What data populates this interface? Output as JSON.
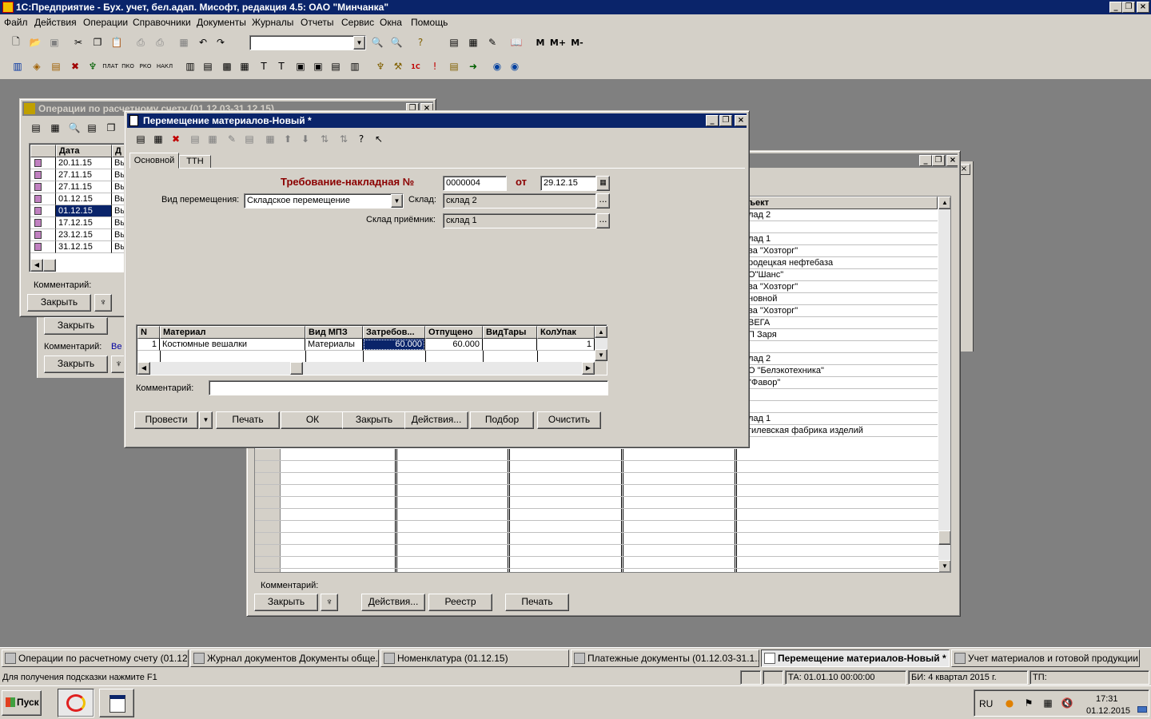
{
  "app": {
    "title": "1С:Предприятие - Бух. учет, бел.адап. Мисофт, редакция 4.5: ОАО \"Минчанка\""
  },
  "menu": [
    "Файл",
    "Действия",
    "Операции",
    "Справочники",
    "Документы",
    "Журналы",
    "Отчеты",
    "Сервис",
    "Окна",
    "Помощь"
  ],
  "toolbar": {
    "m_label": "M",
    "mplus_label": "M+",
    "mminus_label": "M-"
  },
  "win_ops": {
    "title": "Операции по расчетному счету (01.12.03-31.12.15)",
    "col_date": "Дата",
    "col_2": "Д",
    "rows": [
      {
        "date": "20.11.15",
        "d": "Вы"
      },
      {
        "date": "27.11.15",
        "d": "Вы"
      },
      {
        "date": "27.11.15",
        "d": "Вы"
      },
      {
        "date": "01.12.15",
        "d": "Вы"
      },
      {
        "date": "01.12.15",
        "d": "Вы"
      },
      {
        "date": "17.12.15",
        "d": "Вы"
      },
      {
        "date": "23.12.15",
        "d": "Вы"
      },
      {
        "date": "31.12.15",
        "d": "Вы"
      }
    ],
    "comment_label": "Комментарий:",
    "close_label": "Закрыть"
  },
  "win_behind": {
    "close_label": "Закрыть",
    "comment_label": "Комментарий:",
    "comment_value": "Ве",
    "close2_label": "Закрыть"
  },
  "win_journal": {
    "col_object": "ъект",
    "rows": [
      "лад 2",
      "",
      "лад 1",
      "ва \"Хозторг\"",
      "родецкая нефтебаза",
      "О\"Шанс\"",
      "ва \"Хозторг\"",
      "новной",
      "ва \"Хозторг\"",
      "ВЕГА",
      "П Заря",
      "",
      "лад 2",
      "О \"Белэкотехника\"",
      "\"Фавор\"",
      "",
      "",
      "лад 1",
      "гилевская фабрика изделий"
    ],
    "comment_label": "Комментарий:",
    "close_label": "Закрыть",
    "actions_label": "Действия...",
    "registry_label": "Реестр",
    "print_label": "Печать"
  },
  "win_main": {
    "title": "Перемещение материалов-Новый *",
    "tabs": [
      "Основной",
      "ТТН"
    ],
    "doc_title": "Требование-накладная №",
    "doc_number": "0000004",
    "from_label": "от",
    "doc_date": "29.12.15",
    "move_type_label": "Вид перемещения:",
    "move_type_value": "Складское перемещение",
    "warehouse_label": "Склад:",
    "warehouse_value": "склад 2",
    "receiver_label": "Склад приёмник:",
    "receiver_value": "склад 1",
    "columns": [
      "N",
      "Материал",
      "Вид МПЗ",
      "Затребов...",
      "Отпущено",
      "ВидТары",
      "КолУпак"
    ],
    "rows": [
      {
        "n": "1",
        "material": "Костюмные вешалки",
        "type": "Материалы",
        "requested": "60.000",
        "released": "60.000",
        "tare": "",
        "pack": "1"
      }
    ],
    "comment_label": "Комментарий:",
    "comment_value": "",
    "buttons": {
      "post": "Провести",
      "print": "Печать",
      "ok": "ОК",
      "close": "Закрыть",
      "actions": "Действия...",
      "select": "Подбор",
      "clear": "Очистить"
    }
  },
  "taskbar_windows": [
    "Операции по расчетному счету (01.12....",
    "Журнал документов  Документы обще...",
    "Номенклатура  (01.12.15)",
    "Платежные документы (01.12.03-31.1...",
    "Перемещение материалов-Новый *",
    "Учет материалов и готовой продукции..."
  ],
  "status": {
    "hint": "Для получения подсказки нажмите F1",
    "ta": "ТА: 01.01.10  00:00:00",
    "bi": "БИ: 4 квартал 2015 г.",
    "tp": "ТП:"
  },
  "os_taskbar": {
    "start": "Пуск",
    "lang": "RU",
    "time": "17:31",
    "date": "01.12.2015"
  }
}
